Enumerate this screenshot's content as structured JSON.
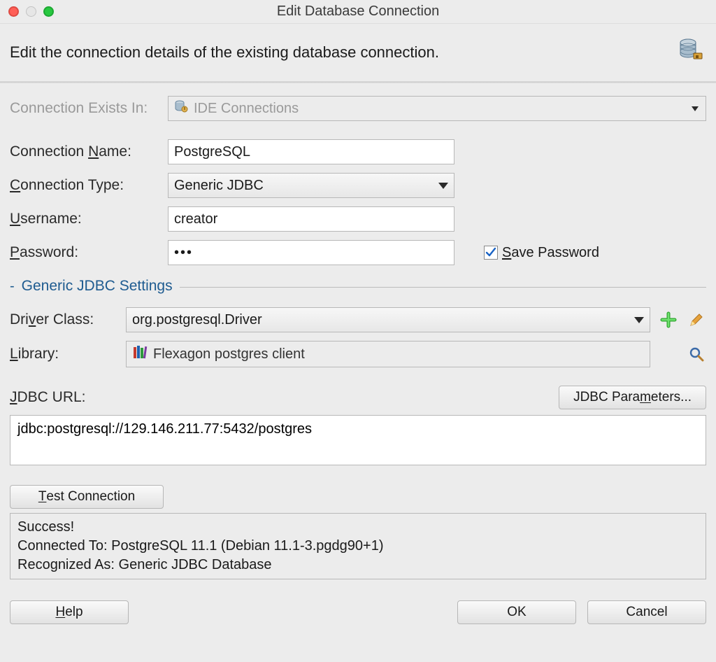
{
  "window": {
    "title": "Edit Database Connection",
    "headerText": "Edit the connection details of the existing database connection."
  },
  "form": {
    "existsIn": {
      "label": "Connection Exists In:",
      "value": "IDE Connections"
    },
    "connectionName": {
      "label_pre": "Connection ",
      "label_ul": "N",
      "label_post": "ame:",
      "value": "PostgreSQL"
    },
    "connectionType": {
      "label_ul": "C",
      "label_post": "onnection Type:",
      "value": "Generic JDBC"
    },
    "username": {
      "label_ul": "U",
      "label_post": "sername:",
      "value": "creator"
    },
    "password": {
      "label_ul": "P",
      "label_post": "assword:",
      "value": "•••"
    },
    "savePassword": {
      "checked": true,
      "label_ul": "S",
      "label_post": "ave Password"
    }
  },
  "section": {
    "title": "Generic JDBC Settings",
    "driverClass": {
      "label_pre": "Dri",
      "label_ul": "v",
      "label_post": "er Class:",
      "value": "org.postgresql.Driver"
    },
    "library": {
      "label_ul": "L",
      "label_post": "ibrary:",
      "value": "Flexagon postgres client"
    },
    "jdbcUrl": {
      "label_ul": "J",
      "label_post": "DBC URL:",
      "paramsButton_pre": "JDBC Para",
      "paramsButton_ul": "m",
      "paramsButton_post": "eters...",
      "value": "jdbc:postgresql://129.146.211.77:5432/postgres"
    },
    "testButton_ul": "T",
    "testButton_post": "est Connection",
    "result": {
      "line1": "Success!",
      "line2": "Connected To: PostgreSQL 11.1 (Debian 11.1-3.pgdg90+1)",
      "line3": "Recognized As: Generic JDBC Database"
    }
  },
  "footer": {
    "help_ul": "H",
    "help_post": "elp",
    "ok": "OK",
    "cancel": "Cancel"
  }
}
